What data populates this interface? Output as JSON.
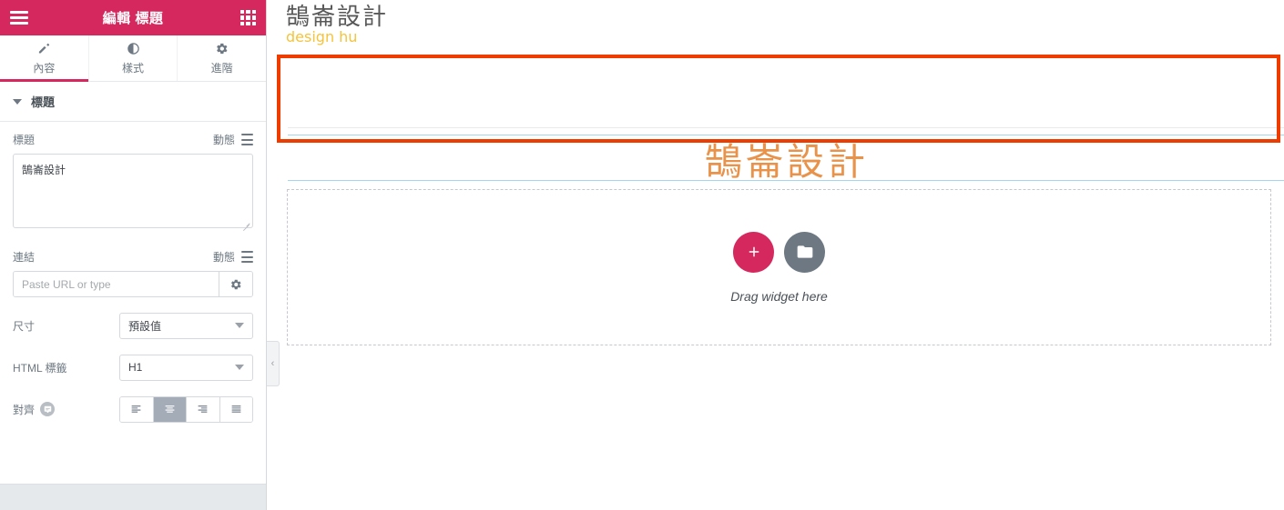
{
  "panel": {
    "header": {
      "title": "編輯 標題",
      "menu_icon": "hamburger-icon",
      "apps_icon": "grid-apps-icon"
    },
    "tabs": [
      {
        "label": "內容",
        "icon": "pencil-icon",
        "active": true
      },
      {
        "label": "樣式",
        "icon": "contrast-icon",
        "active": false
      },
      {
        "label": "進階",
        "icon": "gear-icon",
        "active": false
      }
    ],
    "section": {
      "title": "標題"
    },
    "title_control": {
      "label": "標題",
      "dynamic_label": "動態",
      "dynamic_icon": "stack-icon",
      "value": "鵠崙設計"
    },
    "link_control": {
      "label": "連結",
      "dynamic_label": "動態",
      "dynamic_icon": "stack-icon",
      "placeholder": "Paste URL or type",
      "value": "",
      "settings_icon": "gear-icon"
    },
    "size_control": {
      "label": "尺寸",
      "value": "預設值"
    },
    "html_tag_control": {
      "label": "HTML 標籤",
      "value": "H1"
    },
    "align_control": {
      "label": "對齊",
      "info_icon": "info-bubble-icon",
      "options": [
        {
          "name": "align-left",
          "selected": false
        },
        {
          "name": "align-center",
          "selected": true
        },
        {
          "name": "align-right",
          "selected": false
        },
        {
          "name": "align-justify",
          "selected": false
        }
      ]
    },
    "collapse_handle": {
      "glyph": "‹"
    }
  },
  "canvas": {
    "logo": {
      "main": "鵠崙設計",
      "sub": "design hu"
    },
    "heading": {
      "text": "鵠崙設計"
    },
    "dropzone": {
      "label": "Drag widget here",
      "add_icon": "plus-icon",
      "folder_icon": "folder-icon"
    }
  },
  "colors": {
    "brand_pink": "#d5285e",
    "annotation_red": "#ee3b00",
    "selection_blue": "#a5d7ec",
    "heading_orange": "#e8924a",
    "logo_yellow": "#f5c33b",
    "gray_button": "#6d7882"
  }
}
